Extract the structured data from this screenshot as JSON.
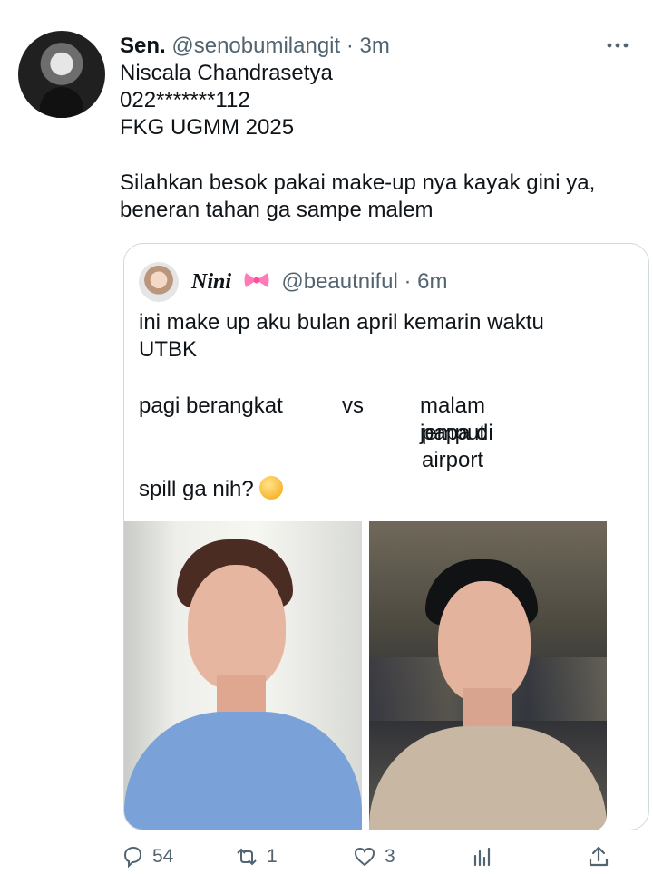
{
  "tweet": {
    "author_name": "Sen.",
    "author_handle": "@senobumilangit",
    "separator": "·",
    "time": "3m",
    "lines": [
      "Niscala Chandrasetya",
      "022*******112",
      "FKG UGMM 2025",
      "",
      "Silahkan besok pakai make-up nya kayak gini ya,",
      "beneran tahan ga sampe malem"
    ]
  },
  "quote": {
    "author_name": "Nini",
    "author_handle": "@beautniful",
    "separator": "·",
    "time": "6m",
    "lines": [
      "ini make up aku bulan april kemarin waktu",
      "UTBK"
    ],
    "comparison": {
      "left": "pagi berangkat",
      "middle": "vs",
      "right_line1": "malam jemput",
      "right_line2": "papa di airport"
    },
    "question": "spill ga nih?"
  },
  "actions": {
    "reply_count": "54",
    "retweet_count": "1",
    "like_count": "3"
  },
  "colors": {
    "text": "#0f1419",
    "secondary": "#536471",
    "border": "#cfd9de"
  },
  "icons": {
    "more": "more-icon",
    "reply": "reply-icon",
    "retweet": "retweet-icon",
    "like": "heart-icon",
    "stats": "stats-icon",
    "share": "share-icon"
  }
}
